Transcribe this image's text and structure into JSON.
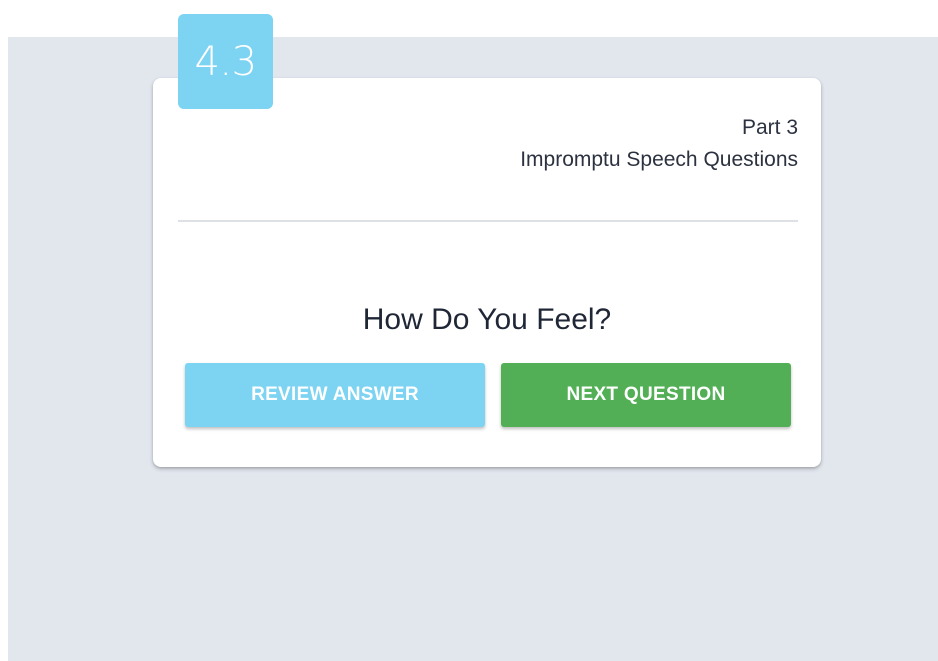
{
  "badge": {
    "number": "4.3",
    "color": "#7dd3f2"
  },
  "header": {
    "part_label": "Part 3",
    "subtitle": "Impromptu Speech Questions"
  },
  "question": {
    "title": "How Do You Feel?"
  },
  "actions": {
    "review_label": "REVIEW ANSWER",
    "review_color": "#7dd3f2",
    "next_label": "NEXT QUESTION",
    "next_color": "#52af56"
  }
}
